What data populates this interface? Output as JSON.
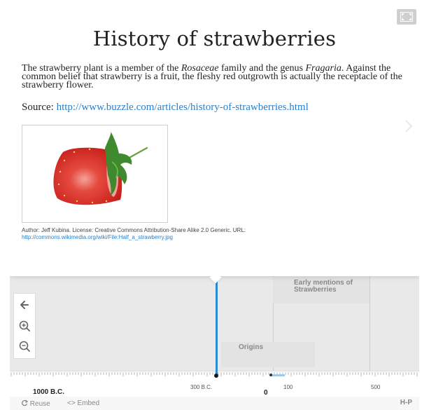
{
  "slide": {
    "title": "History of strawberries",
    "intro": {
      "part1": "The strawberry plant is a member of the ",
      "family": "Rosaceae",
      "part2": " family and the genus ",
      "genus": "Fragaria",
      "part3": ". Against the common belief that strawberry is a fruit, the fleshy red outgrowth is actually the receptacle of the strawberry flower."
    },
    "source_label": "Source: ",
    "source_url": "http://www.buzzle.com/articles/history-of-strawberries.html",
    "image_credit": "Author: Jeff Kubina. License: Creative Commons Attribution-Share Alike 2.0 Generic. URL:",
    "image_credit_url": "http://commons.wikimedia.org/wiki/File:Half_a_strawberry.jpg"
  },
  "timeline": {
    "events": {
      "early": "Early mentions of Strawberries",
      "origins": "Origins"
    },
    "ruler": {
      "big_label": "1000 B.C.",
      "label_300bc": "300 B.C.",
      "label_0": "0",
      "label_100": "100",
      "label_500": "500"
    }
  },
  "footer": {
    "reuse": "Reuse",
    "embed": "Embed",
    "brand": "H-P"
  },
  "colors": {
    "accent": "#2a8bd4",
    "link": "#2b7fc9",
    "strawberry": "#e0302b"
  },
  "icons": [
    "fullscreen-icon",
    "chevron-right-icon",
    "back-arrow-icon",
    "zoom-in-icon",
    "zoom-out-icon",
    "reuse-icon",
    "embed-icon"
  ]
}
